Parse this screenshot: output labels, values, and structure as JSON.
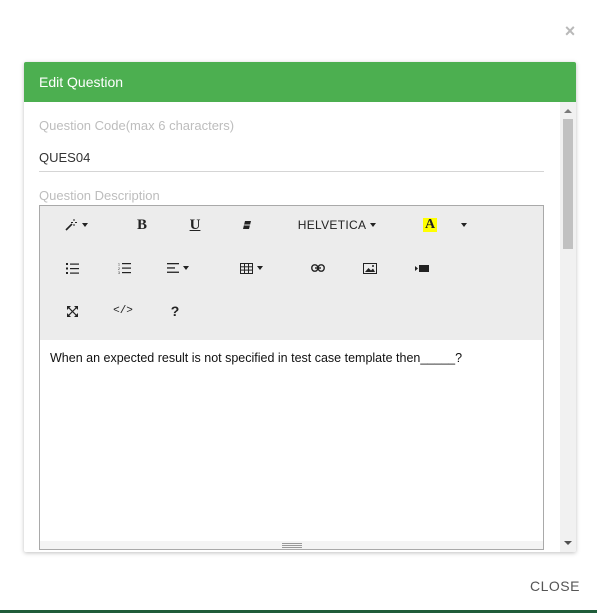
{
  "dialog": {
    "close_icon": "×",
    "title": "Edit Question",
    "close_button_label": "CLOSE"
  },
  "form": {
    "code_label": "Question Code(max 6 characters)",
    "code_value": "QUES04",
    "description_label": "Question Description"
  },
  "editor": {
    "toolbar": {
      "style_icon": "magic-wand-icon",
      "bold_label": "B",
      "underline_label": "U",
      "clear_format_icon": "eraser-icon",
      "font_name": "HELVETICA",
      "color_label": "A",
      "color_highlight": "#ffff00",
      "unordered_list_icon": "unordered-list-icon",
      "ordered_list_icon": "ordered-list-icon",
      "paragraph_icon": "align-left-icon",
      "table_icon": "table-icon",
      "link_icon": "link-icon",
      "picture_icon": "picture-icon",
      "video_icon": "video-icon",
      "fullscreen_icon": "expand-icon",
      "codeview_label": "</>",
      "help_label": "?"
    },
    "content": "When an expected result is not specified in test case template then_____?"
  },
  "colors": {
    "header": "#4caf50",
    "toolbar_bg": "#ececec"
  }
}
